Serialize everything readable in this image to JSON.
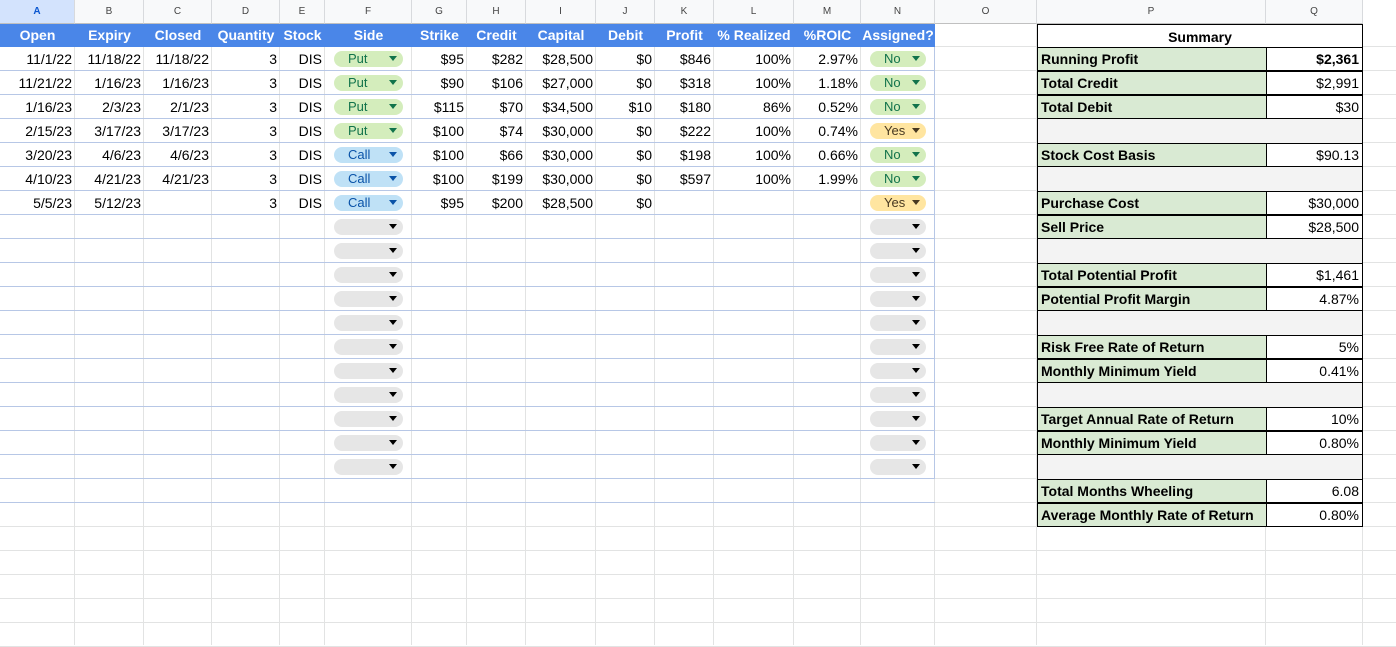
{
  "columns": [
    "A",
    "B",
    "C",
    "D",
    "E",
    "F",
    "G",
    "H",
    "I",
    "J",
    "K",
    "L",
    "M",
    "N",
    "O",
    "P",
    "Q"
  ],
  "selected_column": "A",
  "table": {
    "headers": [
      "Open",
      "Expiry",
      "Closed",
      "Quantity",
      "Stock",
      "Side",
      "Strike",
      "Credit",
      "Capital",
      "Debit",
      "Profit",
      "% Realized",
      "%ROIC",
      "Assigned?"
    ],
    "rows": [
      {
        "open": "11/1/22",
        "expiry": "11/18/22",
        "closed": "11/18/22",
        "quantity": "3",
        "stock": "DIS",
        "side": "Put",
        "strike": "$95",
        "credit": "$282",
        "capital": "$28,500",
        "debit": "$0",
        "profit": "$846",
        "realized": "100%",
        "roic": "2.97%",
        "assigned": "No"
      },
      {
        "open": "11/21/22",
        "expiry": "1/16/23",
        "closed": "1/16/23",
        "quantity": "3",
        "stock": "DIS",
        "side": "Put",
        "strike": "$90",
        "credit": "$106",
        "capital": "$27,000",
        "debit": "$0",
        "profit": "$318",
        "realized": "100%",
        "roic": "1.18%",
        "assigned": "No"
      },
      {
        "open": "1/16/23",
        "expiry": "2/3/23",
        "closed": "2/1/23",
        "quantity": "3",
        "stock": "DIS",
        "side": "Put",
        "strike": "$115",
        "credit": "$70",
        "capital": "$34,500",
        "debit": "$10",
        "profit": "$180",
        "realized": "86%",
        "roic": "0.52%",
        "assigned": "No"
      },
      {
        "open": "2/15/23",
        "expiry": "3/17/23",
        "closed": "3/17/23",
        "quantity": "3",
        "stock": "DIS",
        "side": "Put",
        "strike": "$100",
        "credit": "$74",
        "capital": "$30,000",
        "debit": "$0",
        "profit": "$222",
        "realized": "100%",
        "roic": "0.74%",
        "assigned": "Yes"
      },
      {
        "open": "3/20/23",
        "expiry": "4/6/23",
        "closed": "4/6/23",
        "quantity": "3",
        "stock": "DIS",
        "side": "Call",
        "strike": "$100",
        "credit": "$66",
        "capital": "$30,000",
        "debit": "$0",
        "profit": "$198",
        "realized": "100%",
        "roic": "0.66%",
        "assigned": "No"
      },
      {
        "open": "4/10/23",
        "expiry": "4/21/23",
        "closed": "4/21/23",
        "quantity": "3",
        "stock": "DIS",
        "side": "Call",
        "strike": "$100",
        "credit": "$199",
        "capital": "$30,000",
        "debit": "$0",
        "profit": "$597",
        "realized": "100%",
        "roic": "1.99%",
        "assigned": "No"
      },
      {
        "open": "5/5/23",
        "expiry": "5/12/23",
        "closed": "",
        "quantity": "3",
        "stock": "DIS",
        "side": "Call",
        "strike": "$95",
        "credit": "$200",
        "capital": "$28,500",
        "debit": "$0",
        "profit": "",
        "realized": "",
        "roic": "",
        "assigned": "Yes"
      }
    ],
    "empty_dropdown_rows": 11
  },
  "summary": {
    "title": "Summary",
    "groups": [
      [
        {
          "label": "Running Profit",
          "value": "$2,361",
          "bold": true
        },
        {
          "label": "Total Credit",
          "value": "$2,991"
        },
        {
          "label": "Total Debit",
          "value": "$30"
        }
      ],
      [
        {
          "label": "Stock Cost Basis",
          "value": "$90.13"
        }
      ],
      [
        {
          "label": "Purchase Cost",
          "value": "$30,000"
        },
        {
          "label": "Sell Price",
          "value": "$28,500"
        }
      ],
      [
        {
          "label": "Total Potential Profit",
          "value": "$1,461"
        },
        {
          "label": "Potential Profit Margin",
          "value": "4.87%"
        }
      ],
      [
        {
          "label": "Risk Free Rate of Return",
          "value": "5%"
        },
        {
          "label": "Monthly Minimum Yield",
          "value": "0.41%"
        }
      ],
      [
        {
          "label": "Target Annual Rate of Return",
          "value": "10%"
        },
        {
          "label": "Monthly Minimum Yield",
          "value": "0.80%"
        }
      ],
      [
        {
          "label": "Total Months Wheeling",
          "value": "6.08"
        },
        {
          "label": "Average Monthly Rate of Return",
          "value": "0.80%"
        }
      ]
    ]
  },
  "colors": {
    "header_blue": "#4a86e8",
    "put_chip": "#d4edbc",
    "call_chip": "#bfe1f6",
    "yes_chip": "#ffe5a0",
    "summary_label": "#d9ead3"
  }
}
